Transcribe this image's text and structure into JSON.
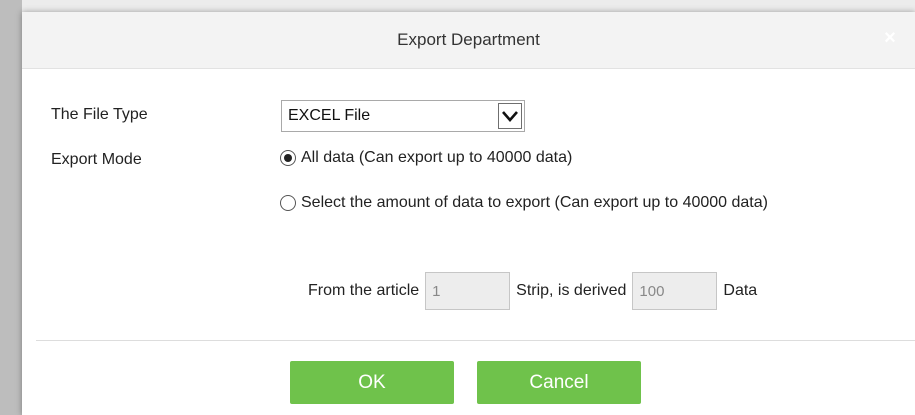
{
  "dialog": {
    "title": "Export Department",
    "close_symbol": "×"
  },
  "form": {
    "file_type_label": "The File Type",
    "file_type_value": "EXCEL File",
    "export_mode_label": "Export Mode",
    "option_all": "All data (Can export up to 40000 data)",
    "option_select": "Select the amount of data to export (Can export up to 40000 data)",
    "option_all_checked": true,
    "range_from_label": "From the article",
    "range_from_value": "1",
    "range_mid_label": "Strip, is derived",
    "range_count_value": "100",
    "range_end_label": "Data"
  },
  "buttons": {
    "ok": "OK",
    "cancel": "Cancel"
  },
  "colors": {
    "button_green": "#6fc24b",
    "titlebar": "#f3f3f3"
  }
}
